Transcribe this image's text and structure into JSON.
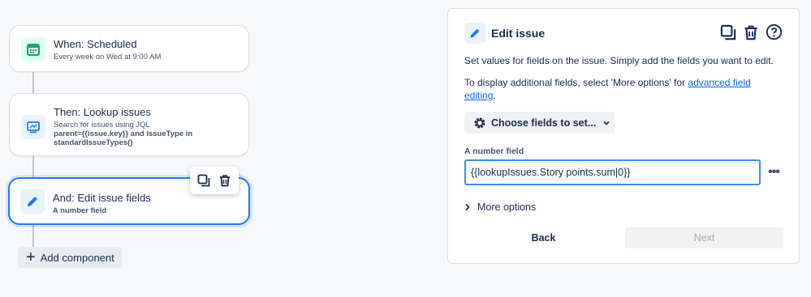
{
  "flow": {
    "trigger": {
      "title": "When: Scheduled",
      "subtitle": "Every week on Wed at 9:00 AM",
      "icon": "calendar-icon",
      "color": "#22a06b"
    },
    "action_lookup": {
      "title": "Then: Lookup issues",
      "subtitle_line1": "Search for issues using JQL",
      "subtitle_line2": "parent={{issue.key}} and issueType in",
      "subtitle_line3": "standardIssueTypes()",
      "icon": "monitor-icon",
      "color": "#1d7afc"
    },
    "action_edit": {
      "title": "And: Edit issue fields",
      "subtitle": "A number field",
      "icon": "pencil-icon",
      "color": "#1d7afc"
    },
    "add_component_label": "Add component"
  },
  "panel": {
    "title": "Edit issue",
    "description": "Set values for fields on the issue. Simply add the fields you want to edit.",
    "more_text_before": "To display additional fields, select 'More options' for ",
    "more_text_link": "advanced field editing",
    "more_text_after": ".",
    "choose_fields_label": "Choose fields to set...",
    "field_label": "A number field",
    "field_value": "{{lookupIssues.Story points.sum|0}}",
    "more_options_label": "More options",
    "back_label": "Back",
    "next_label": "Next",
    "accent_color": "#0c66e4"
  }
}
